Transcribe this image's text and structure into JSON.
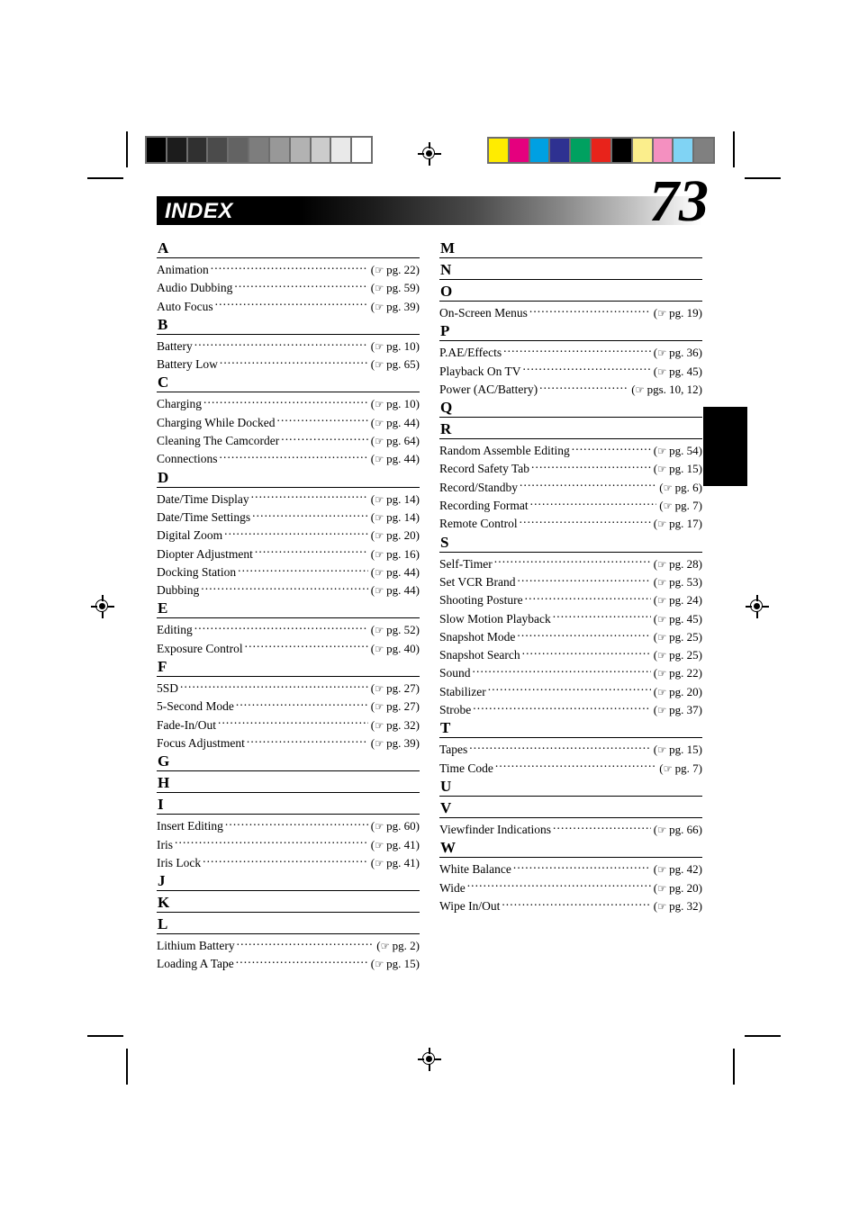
{
  "document": {
    "section_title": "INDEX",
    "page_number": "73",
    "reference_icon": "pointing-hand-icon"
  },
  "calibration": {
    "grayscale_strip": [
      "#000000",
      "#1c1c1c",
      "#303030",
      "#4b4b4b",
      "#636363",
      "#7d7d7d",
      "#989898",
      "#b2b2b2",
      "#cccccc",
      "#e9e9e9",
      "#ffffff"
    ],
    "color_strip": [
      "#ffec00",
      "#e5007e",
      "#00a0e2",
      "#2e3191",
      "#00a160",
      "#e8231b",
      "#000000",
      "#fbee8c",
      "#f490c0",
      "#80d3f4",
      "#808080"
    ]
  },
  "columns": [
    {
      "name": "left-column",
      "sections": [
        {
          "letter": "A",
          "entries": [
            {
              "name": "Animation",
              "ref": "pg. 22"
            },
            {
              "name": "Audio Dubbing",
              "ref": "pg. 59"
            },
            {
              "name": "Auto Focus",
              "ref": "pg. 39"
            }
          ]
        },
        {
          "letter": "B",
          "entries": [
            {
              "name": "Battery",
              "ref": "pg. 10"
            },
            {
              "name": "Battery Low",
              "ref": "pg. 65"
            }
          ]
        },
        {
          "letter": "C",
          "entries": [
            {
              "name": "Charging",
              "ref": "pg. 10"
            },
            {
              "name": "Charging While Docked",
              "ref": "pg. 44"
            },
            {
              "name": "Cleaning The Camcorder",
              "ref": "pg. 64"
            },
            {
              "name": "Connections",
              "ref": "pg. 44"
            }
          ]
        },
        {
          "letter": "D",
          "entries": [
            {
              "name": "Date/Time Display",
              "ref": "pg. 14"
            },
            {
              "name": "Date/Time Settings",
              "ref": "pg. 14"
            },
            {
              "name": "Digital Zoom",
              "ref": "pg. 20"
            },
            {
              "name": "Diopter Adjustment",
              "ref": "pg. 16"
            },
            {
              "name": "Docking Station",
              "ref": "pg. 44"
            },
            {
              "name": "Dubbing",
              "ref": "pg. 44"
            }
          ]
        },
        {
          "letter": "E",
          "entries": [
            {
              "name": "Editing",
              "ref": "pg. 52"
            },
            {
              "name": "Exposure Control",
              "ref": "pg. 40"
            }
          ]
        },
        {
          "letter": "F",
          "entries": [
            {
              "name": "5SD",
              "ref": "pg. 27"
            },
            {
              "name": "5-Second Mode",
              "ref": "pg. 27"
            },
            {
              "name": "Fade-In/Out",
              "ref": "pg. 32"
            },
            {
              "name": "Focus Adjustment",
              "ref": "pg. 39"
            }
          ]
        },
        {
          "letter": "G",
          "entries": []
        },
        {
          "letter": "H",
          "entries": []
        },
        {
          "letter": "I",
          "entries": [
            {
              "name": "Insert Editing",
              "ref": "pg. 60"
            },
            {
              "name": "Iris",
              "ref": "pg. 41"
            },
            {
              "name": "Iris Lock",
              "ref": "pg. 41"
            }
          ]
        },
        {
          "letter": "J",
          "entries": []
        },
        {
          "letter": "K",
          "entries": []
        },
        {
          "letter": "L",
          "entries": [
            {
              "name": "Lithium Battery",
              "ref": "pg. 2"
            },
            {
              "name": "Loading A Tape",
              "ref": "pg. 15"
            }
          ]
        }
      ]
    },
    {
      "name": "right-column",
      "sections": [
        {
          "letter": "M",
          "entries": []
        },
        {
          "letter": "N",
          "entries": []
        },
        {
          "letter": "O",
          "entries": [
            {
              "name": "On-Screen Menus",
              "ref": "pg. 19"
            }
          ]
        },
        {
          "letter": "P",
          "entries": [
            {
              "name": "P.AE/Effects",
              "ref": "pg. 36"
            },
            {
              "name": "Playback On TV",
              "ref": "pg. 45"
            },
            {
              "name": "Power (AC/Battery)",
              "ref": "pgs. 10, 12"
            }
          ]
        },
        {
          "letter": "Q",
          "entries": []
        },
        {
          "letter": "R",
          "entries": [
            {
              "name": "Random Assemble Editing",
              "ref": "pg. 54"
            },
            {
              "name": "Record Safety Tab",
              "ref": "pg. 15"
            },
            {
              "name": "Record/Standby",
              "ref": "pg. 6"
            },
            {
              "name": "Recording Format",
              "ref": "pg. 7"
            },
            {
              "name": "Remote Control",
              "ref": "pg. 17"
            }
          ]
        },
        {
          "letter": "S",
          "entries": [
            {
              "name": "Self-Timer",
              "ref": "pg. 28"
            },
            {
              "name": "Set VCR Brand",
              "ref": "pg. 53"
            },
            {
              "name": "Shooting Posture",
              "ref": "pg. 24"
            },
            {
              "name": "Slow Motion Playback",
              "ref": "pg. 45"
            },
            {
              "name": "Snapshot Mode",
              "ref": "pg. 25"
            },
            {
              "name": "Snapshot Search",
              "ref": "pg. 25"
            },
            {
              "name": "Sound",
              "ref": "pg. 22"
            },
            {
              "name": "Stabilizer",
              "ref": "pg. 20"
            },
            {
              "name": "Strobe",
              "ref": "pg. 37"
            }
          ]
        },
        {
          "letter": "T",
          "entries": [
            {
              "name": "Tapes",
              "ref": "pg. 15"
            },
            {
              "name": "Time Code",
              "ref": "pg. 7"
            }
          ]
        },
        {
          "letter": "U",
          "entries": []
        },
        {
          "letter": "V",
          "entries": [
            {
              "name": "Viewfinder Indications",
              "ref": "pg. 66"
            }
          ]
        },
        {
          "letter": "W",
          "entries": [
            {
              "name": "White Balance",
              "ref": "pg. 42"
            },
            {
              "name": "Wide",
              "ref": "pg. 20"
            },
            {
              "name": "Wipe In/Out",
              "ref": "pg. 32"
            }
          ]
        }
      ]
    }
  ]
}
